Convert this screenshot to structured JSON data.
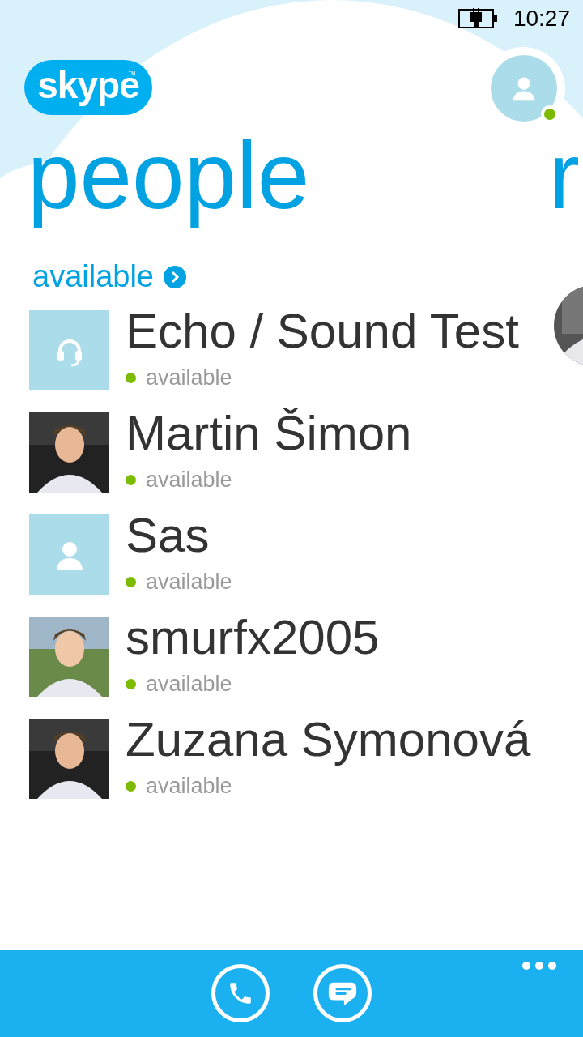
{
  "status_bar": {
    "charging": true,
    "time": "10:27"
  },
  "logo": {
    "text": "skype",
    "mark": "™"
  },
  "profile": {
    "online": true
  },
  "pivot": {
    "title": "people",
    "next_title": "r"
  },
  "filter": {
    "label": "available"
  },
  "contacts": [
    {
      "name": "Echo / Sound Test",
      "status": "available",
      "kind": "echo"
    },
    {
      "name": "Martin Šimon",
      "status": "available"
    },
    {
      "name": "Sas",
      "status": "available",
      "kind": "placeholder"
    },
    {
      "name": "smurfx2005",
      "status": "available"
    },
    {
      "name": "Zuzana Symonová",
      "status": "available"
    }
  ],
  "app_bar": {
    "buttons": [
      {
        "kind": "call"
      },
      {
        "kind": "chat"
      }
    ]
  }
}
